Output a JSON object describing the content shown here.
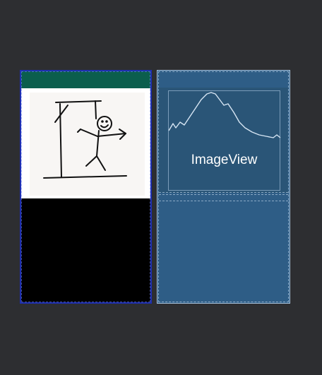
{
  "design_view": {
    "toolbar_color": "#0b5e4d",
    "image_icon": "hangman-drawing-icon",
    "frame_border_color": "#1e2fb0"
  },
  "blueprint_view": {
    "image_view_label": "ImageView",
    "image_placeholder_icon": "mountain-image-icon",
    "background_color": "#2e5d86"
  }
}
